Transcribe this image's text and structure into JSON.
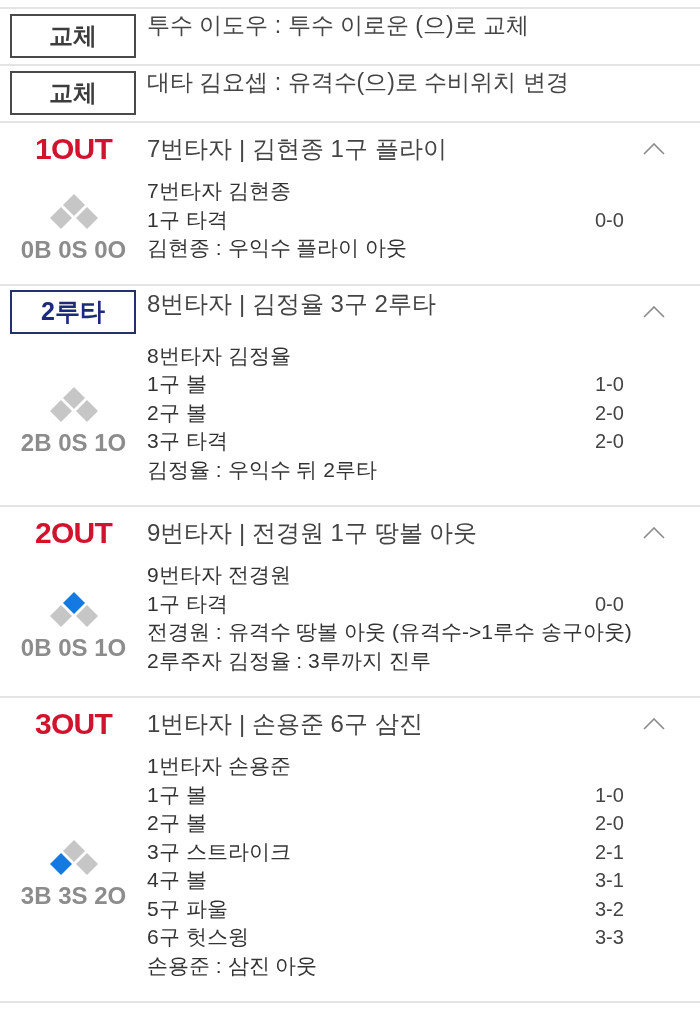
{
  "events": [
    {
      "kind": "substitution",
      "badge": "교체",
      "text": "투수 이도우 : 투수 이로운 (으)로 교체"
    },
    {
      "kind": "substitution",
      "badge": "교체",
      "text": "대타 김요셉 : 유격수(으)로 수비위치 변경"
    },
    {
      "kind": "at_bat",
      "result": {
        "kind": "out",
        "label": "1OUT"
      },
      "title": "7번타자 | 김현종 1구 플라이",
      "expanded": true,
      "bases": {
        "first": false,
        "second": false,
        "third": false
      },
      "count": "0B 0S 0O",
      "lines": [
        {
          "text": "7번타자 김현종"
        },
        {
          "text": "1구 타격",
          "count": "0-0"
        },
        {
          "text": "김현종 : 우익수 플라이 아웃"
        }
      ]
    },
    {
      "kind": "at_bat",
      "result": {
        "kind": "hit",
        "label": "2루타"
      },
      "title": "8번타자 | 김정율 3구 2루타",
      "expanded": true,
      "bases": {
        "first": false,
        "second": false,
        "third": false
      },
      "count": "2B 0S 1O",
      "lines": [
        {
          "text": "8번타자 김정율"
        },
        {
          "text": "1구 볼",
          "count": "1-0"
        },
        {
          "text": "2구 볼",
          "count": "2-0"
        },
        {
          "text": "3구 타격",
          "count": "2-0"
        },
        {
          "text": "김정율 : 우익수 뒤 2루타"
        }
      ]
    },
    {
      "kind": "at_bat",
      "result": {
        "kind": "out",
        "label": "2OUT"
      },
      "title": "9번타자 | 전경원 1구 땅볼 아웃",
      "expanded": true,
      "bases": {
        "first": false,
        "second": true,
        "third": false
      },
      "count": "0B 0S 1O",
      "lines": [
        {
          "text": "9번타자 전경원"
        },
        {
          "text": "1구 타격",
          "count": "0-0"
        },
        {
          "text": "전경원 : 유격수 땅볼 아웃 (유격수->1루수 송구아웃)"
        },
        {
          "text": "2루주자 김정율 : 3루까지 진루"
        }
      ]
    },
    {
      "kind": "at_bat",
      "result": {
        "kind": "out",
        "label": "3OUT"
      },
      "title": "1번타자 | 손용준 6구 삼진",
      "expanded": true,
      "bases": {
        "first": false,
        "second": false,
        "third": true
      },
      "count": "3B 3S 2O",
      "lines": [
        {
          "text": "1번타자 손용준"
        },
        {
          "text": "1구 볼",
          "count": "1-0"
        },
        {
          "text": "2구 볼",
          "count": "2-0"
        },
        {
          "text": "3구 스트라이크",
          "count": "2-1"
        },
        {
          "text": "4구 볼",
          "count": "3-1"
        },
        {
          "text": "5구 파울",
          "count": "3-2"
        },
        {
          "text": "6구 헛스윙",
          "count": "3-3"
        },
        {
          "text": "손용준 : 삼진 아웃"
        }
      ]
    }
  ]
}
